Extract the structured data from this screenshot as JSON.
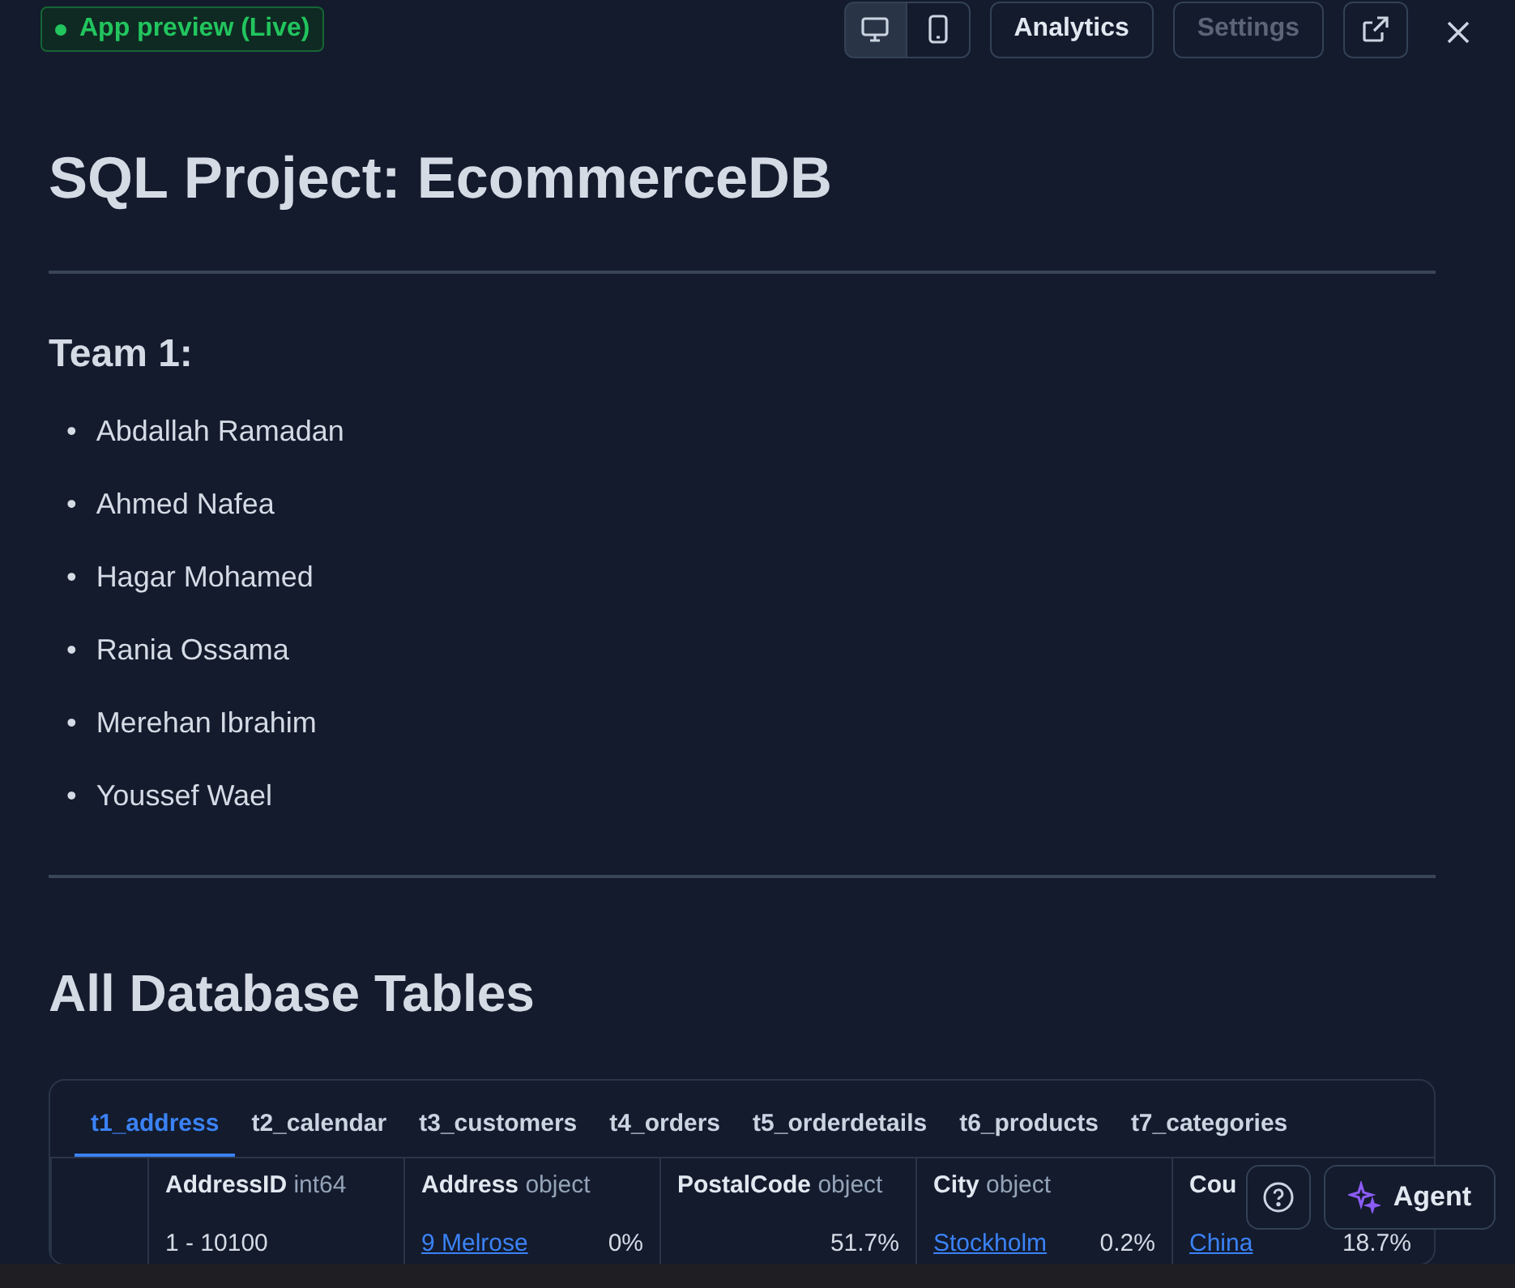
{
  "top_bar": {
    "status_badge": {
      "label": "App preview (Live)",
      "live": true
    },
    "view_toggle": [
      {
        "kind": "desktop",
        "selected": true
      },
      {
        "kind": "mobile",
        "selected": false
      }
    ],
    "buttons": [
      {
        "label": "Analytics",
        "disabled": false
      },
      {
        "label": "Settings",
        "disabled": true
      }
    ]
  },
  "title": "SQL Project: EcommerceDB",
  "team": {
    "heading": "Team 1:",
    "members": [
      {
        "bullet": "•",
        "name": "Abdallah Ramadan"
      },
      {
        "bullet": "•",
        "name": "Ahmed Nafea"
      },
      {
        "bullet": "•",
        "name": "Hagar Mohamed"
      },
      {
        "bullet": "•",
        "name": "Rania Ossama"
      },
      {
        "bullet": "•",
        "name": "Merehan Ibrahim"
      },
      {
        "bullet": "•",
        "name": "Youssef Wael"
      }
    ]
  },
  "tables_heading": "All Database Tables",
  "tabs": [
    {
      "label": "t1_address",
      "selected": true
    },
    {
      "label": "t2_calendar",
      "selected": false
    },
    {
      "label": "t3_customers",
      "selected": false
    },
    {
      "label": "t4_orders",
      "selected": false
    },
    {
      "label": "t5_orderdetails",
      "selected": false
    },
    {
      "label": "t6_products",
      "selected": false
    },
    {
      "label": "t7_categories",
      "selected": false
    }
  ],
  "table": {
    "columns": [
      {
        "name": "AddressID",
        "type": "int64"
      },
      {
        "name": "Address",
        "type": "object"
      },
      {
        "name": "PostalCode",
        "type": "object"
      },
      {
        "name": "City",
        "type": "object"
      },
      {
        "name": "Cou"
      }
    ],
    "first_row": [
      {
        "value": "1 - 10100"
      },
      {
        "value": "9 Melrose",
        "share": "0%"
      },
      {
        "share": "51.7%"
      },
      {
        "value": "Stockholm",
        "share": "0.2%"
      },
      {
        "value": "China",
        "share": "18.7%"
      }
    ]
  },
  "agent_button": {
    "label": "Agent"
  }
}
